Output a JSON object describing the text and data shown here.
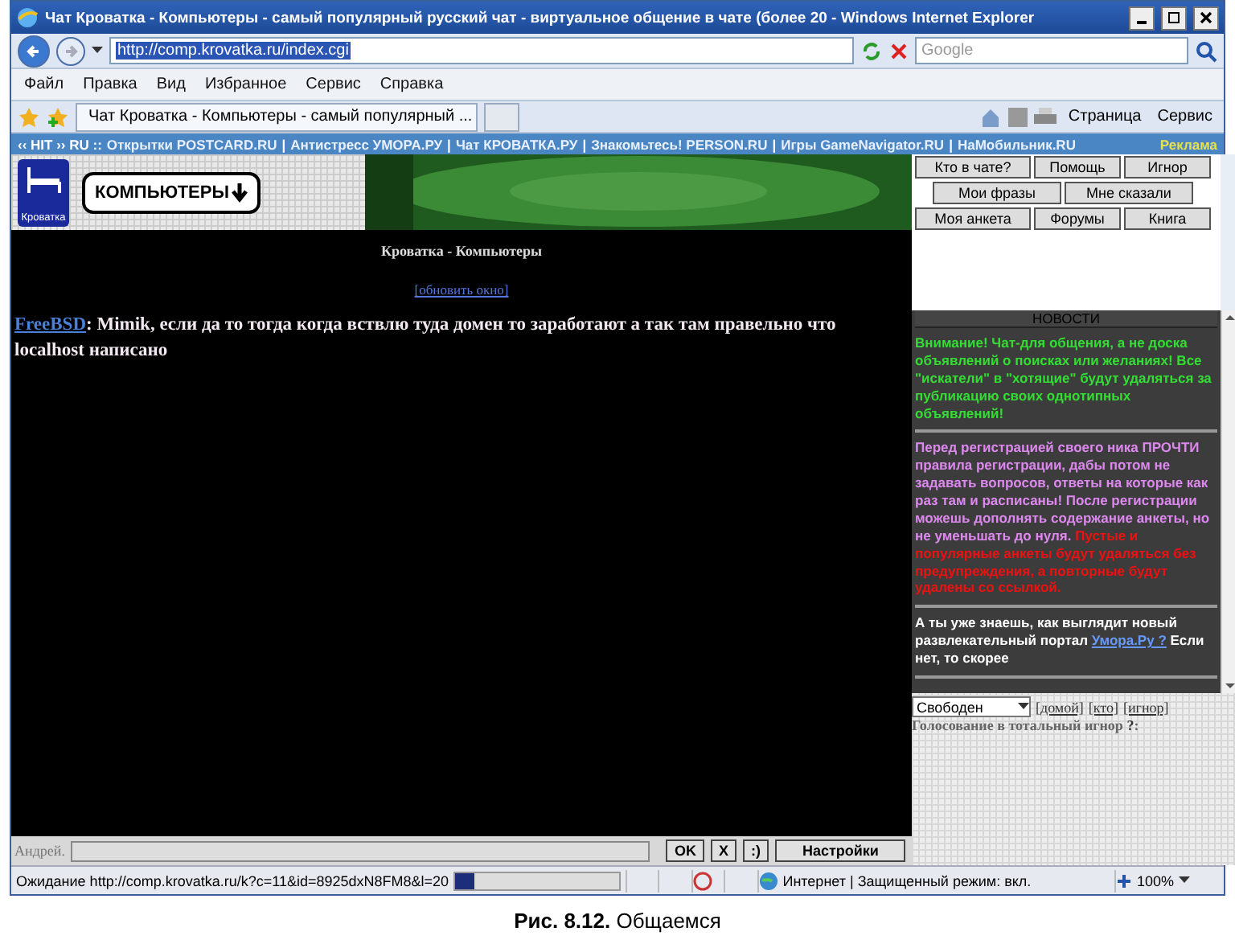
{
  "window": {
    "title": "Чат Кроватка - Компьютеры - самый популярный русский чат - виртуальное общение в чате (более 20 - Windows Internet Explorer"
  },
  "address": {
    "url": "http://comp.krovatka.ru/index.cgi"
  },
  "search": {
    "placeholder": "Google"
  },
  "menu": [
    "Файл",
    "Правка",
    "Вид",
    "Избранное",
    "Сервис",
    "Справка"
  ],
  "tab": {
    "label": "Чат Кроватка - Компьютеры - самый популярный ..."
  },
  "toolbar": [
    "Страница",
    "Сервис"
  ],
  "link_bar": {
    "brand": "‹‹ HIT ›› RU ::",
    "separator": "|",
    "links": [
      "Открытки POSTCARD.RU",
      "Антистресс УМОРА.РУ",
      "Чат КРОВАТКА.РУ",
      "Знакомьтесь! PERSON.RU",
      "Игры GameNavigator.RU",
      "НаМобильник.RU"
    ],
    "ad": "Реклама"
  },
  "chat": {
    "logo_caption": "Кроватка",
    "room_button": "КОМПЬЮТЕРЫ",
    "heading": "Кроватка - Компьютеры",
    "refresh": "[обновить окно]",
    "messages": [
      {
        "author": "FreeBSD",
        "text": ": Mimik, если да то тогда когда вствлю туда домен то заработают а так там правельно что localhost написано"
      }
    ]
  },
  "nav_buttons": [
    [
      "Кто в чате?",
      "Помощь",
      "Игнор"
    ],
    [
      "Мои фразы",
      "Мне сказали"
    ],
    [
      "Моя анкета",
      "Форумы",
      "Книга"
    ]
  ],
  "news": {
    "title": "НОВОСТИ",
    "items": [
      {
        "parts": [
          {
            "text": "Внимание! Чат-для общения, а не доска объявлений о поисках или желаниях! Все \"искатели\" в \"хотящие\" будут удаляться за публикацию своих однотипных объявлений!",
            "color": "#33dd33"
          }
        ]
      },
      {
        "parts": [
          {
            "text": "Перед регистрацией своего ника ПРОЧТИ правила регистрации, дабы потом не задавать вопросов, ответы на которые как раз там и расписаны! После регистрации можешь дополнять содержание анкеты, но не уменьшать до нуля. ",
            "color": "#dd88ee"
          },
          {
            "text": "Пустые и популярные анкеты будут удаляться без предупреждения, а повторные будут удалены со ссылкой.",
            "color": "#ee1111"
          }
        ]
      },
      {
        "parts": [
          {
            "text": "А ты уже знаешь, как выглядит новый развлекательный портал ",
            "color": "#ffffff"
          },
          {
            "text": "Умора.Ру ?",
            "color": "#6699ff",
            "link": true
          },
          {
            "text": " Если нет, то скорее",
            "color": "#ffffff"
          }
        ]
      }
    ]
  },
  "status_select": {
    "value": "Свободен"
  },
  "status_links": [
    "[домой]",
    "[кто]",
    "[игнор]"
  ],
  "vote": {
    "text": "Голосование в тотальный игнор",
    "link": "?",
    "suffix": ":"
  },
  "input_bar": {
    "name": "Андрей.",
    "buttons": [
      "OK",
      "X",
      ":)",
      "Настройки"
    ]
  },
  "status_bar": {
    "text": "Ожидание http://comp.krovatka.ru/k?c=11&id=8925dxN8FM8&l=20",
    "level": 0.12,
    "zone": "Интернет | Защищенный режим: вкл.",
    "zoom": "100%"
  },
  "caption": "**Рис. 8.12.** Общаемся"
}
